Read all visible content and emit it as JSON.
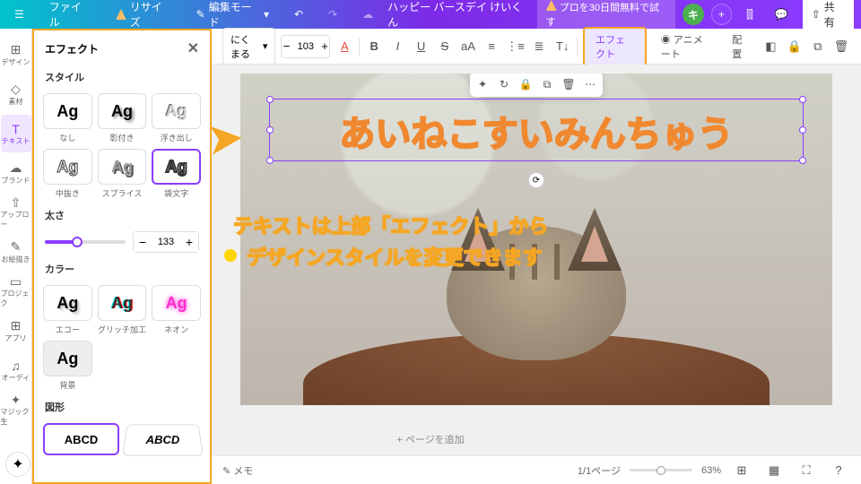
{
  "header": {
    "file": "ファイル",
    "resize": "リサイズ",
    "edit_mode": "編集モード",
    "doc_title": "ハッピー バースデイ けいくん",
    "pro_trial": "プロを30日間無料で試す",
    "avatar_letter": "キ",
    "share": "共有"
  },
  "rail": {
    "design": "デザイン",
    "elements": "素材",
    "text": "テキスト",
    "brand": "ブランド",
    "upload": "アップロー",
    "drawing": "お絵描き",
    "project": "プロジェク",
    "apps": "アプリ",
    "audio": "オーディ",
    "magic": "マジック生"
  },
  "panel": {
    "title": "エフェクト",
    "style_label": "スタイル",
    "styles": {
      "none": "なし",
      "shadow": "影付き",
      "emboss": "浮き出し",
      "hollow": "中抜き",
      "splice": "スプライス",
      "outline": "袋文字",
      "echo": "エコー",
      "glitch": "グリッチ加工",
      "neon": "ネオン",
      "background": "背景"
    },
    "thickness": "太さ",
    "thickness_value": "133",
    "color": "カラー",
    "shape": "図形",
    "sample": "Ag",
    "shape_sample": "ABCD"
  },
  "toolbar": {
    "font": "にくまる",
    "font_size": "103",
    "effects": "エフェクト",
    "animate": "アニメート",
    "position": "配置"
  },
  "canvas": {
    "main_text": "あいねこすいみんちゅう",
    "annotation1": "テキストは上部「エフェクト」から",
    "annotation2": "デザインスタイルを変更できます",
    "add_page": "+ ページを追加"
  },
  "bottom": {
    "memo": "メモ",
    "page": "1/1ページ",
    "zoom": "63%"
  }
}
